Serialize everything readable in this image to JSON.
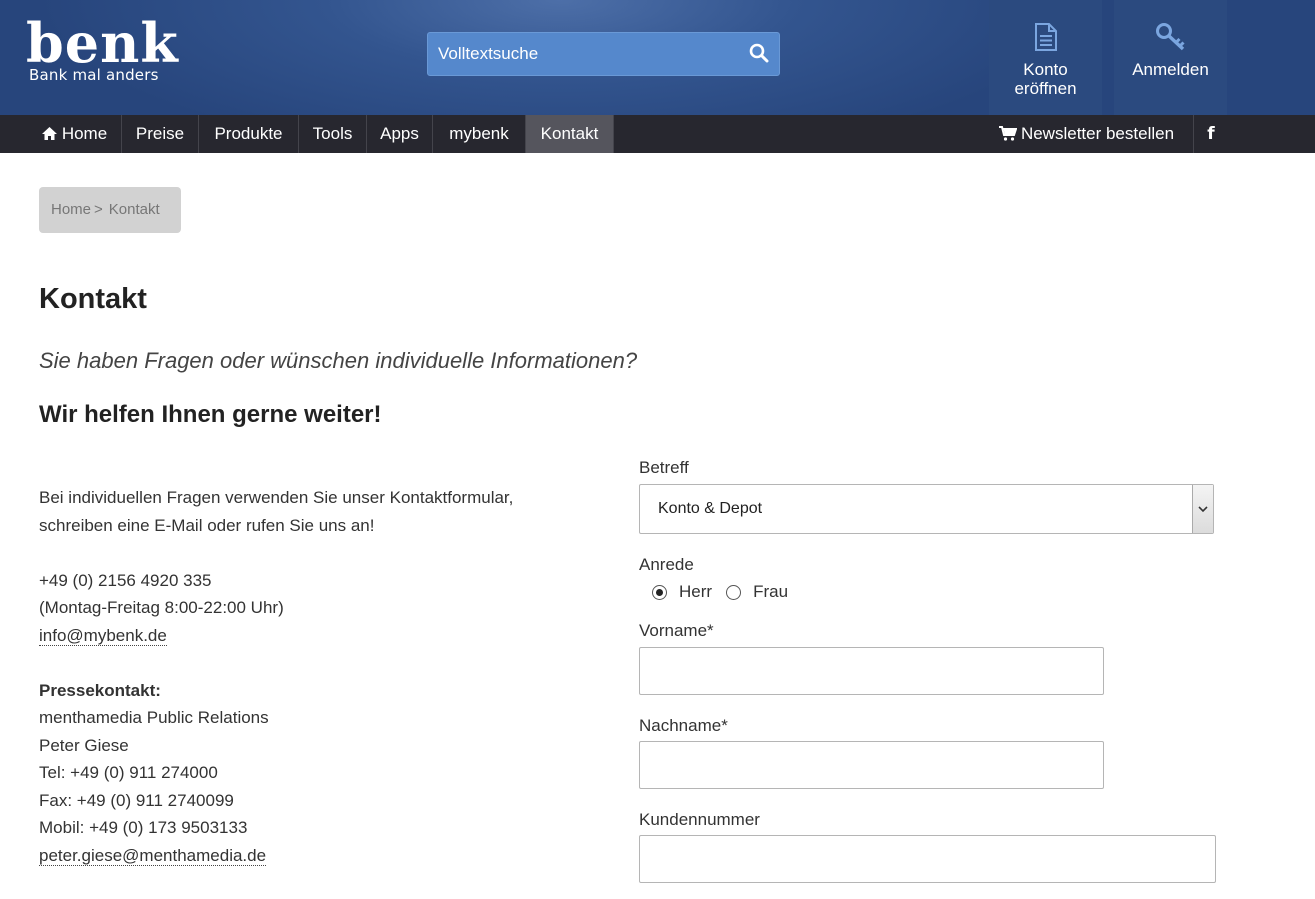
{
  "header": {
    "logo_word": "benk",
    "logo_tagline": "Bank mal anders",
    "search_placeholder": "Volltextsuche",
    "open_account_label_line1": "Konto",
    "open_account_label_line2": "eröffnen",
    "login_label": "Anmelden",
    "colors": {
      "header_bg": "#2e4e86",
      "search_bg": "#5588cc",
      "nav_bg": "#27272f",
      "nav_active": "#55555d"
    }
  },
  "nav": {
    "items": [
      {
        "label": "Home",
        "icon": "home-icon"
      },
      {
        "label": "Preise"
      },
      {
        "label": "Produkte"
      },
      {
        "label": "Tools"
      },
      {
        "label": "Apps"
      },
      {
        "label": "mybenk"
      },
      {
        "label": "Kontakt",
        "active": true
      }
    ],
    "newsletter_label": "Newsletter bestellen",
    "newsletter_icon": "cart-icon",
    "facebook_label": "f"
  },
  "breadcrumb": {
    "home": "Home",
    "separator": ">",
    "current": "Kontakt"
  },
  "page": {
    "title": "Kontakt",
    "intro": "Sie haben Fragen oder wünschen individuelle Informationen?",
    "subhead": "Wir helfen Ihnen gerne weiter!"
  },
  "contact": {
    "text_line1": "Bei individuellen Fragen verwenden Sie unser Kontaktformular,",
    "text_line2": "schreiben eine E-Mail oder rufen Sie uns an!",
    "phone": "+49 (0) 2156 4920 335",
    "hours": "(Montag-Freitag 8:00-22:00 Uhr)",
    "email": "info@mybenk.de",
    "press_title": "Pressekontakt:",
    "press_company": "menthamedia Public Relations",
    "press_name": "Peter Giese",
    "press_tel": "Tel: +49 (0) 911 274000",
    "press_fax": "Fax: +49 (0) 911 2740099",
    "press_mobile": "Mobil: +49 (0) 173 9503133",
    "press_email": "peter.giese@menthamedia.de"
  },
  "form": {
    "subject_label": "Betreff",
    "subject_value": "Konto & Depot",
    "salutation_label": "Anrede",
    "salutation_options": [
      "Herr",
      "Frau"
    ],
    "salutation_selected": "Herr",
    "firstname_label": "Vorname*",
    "firstname_value": "",
    "lastname_label": "Nachname*",
    "lastname_value": "",
    "customer_number_label": "Kundennummer",
    "customer_number_value": ""
  }
}
